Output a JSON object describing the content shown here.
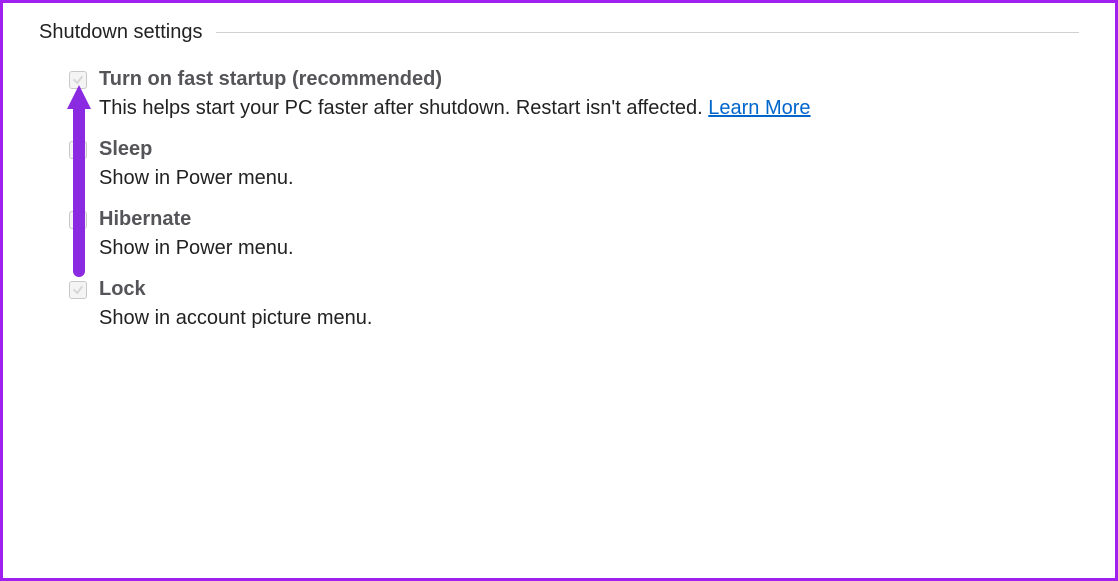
{
  "section": {
    "title": "Shutdown settings"
  },
  "options": {
    "fast_startup": {
      "label": "Turn on fast startup (recommended)",
      "desc_prefix": "This helps start your PC faster after shutdown. Restart isn't affected. ",
      "learn_more": "Learn More",
      "checked": true
    },
    "sleep": {
      "label": "Sleep",
      "desc": "Show in Power menu.",
      "checked": true
    },
    "hibernate": {
      "label": "Hibernate",
      "desc": "Show in Power menu.",
      "checked": false
    },
    "lock": {
      "label": "Lock",
      "desc": "Show in account picture menu.",
      "checked": true
    }
  },
  "annotation": {
    "arrow_color": "#8a2be2"
  }
}
